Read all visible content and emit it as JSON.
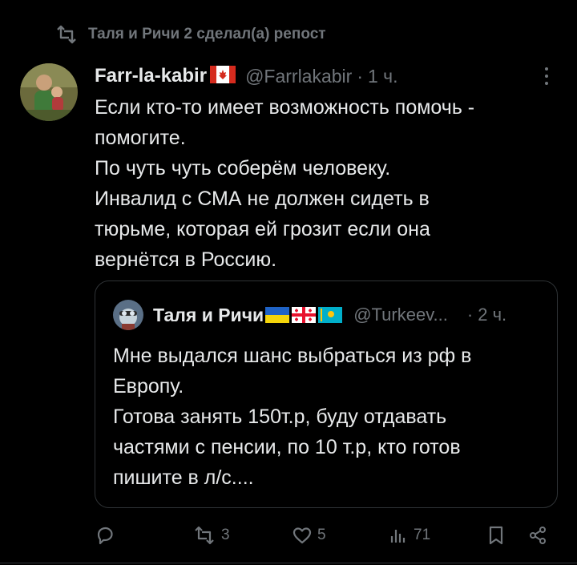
{
  "repost": {
    "label": "Таля и Ричи 2 сделал(а) репост",
    "icon": "repost-icon"
  },
  "tweet": {
    "author_name": "Farr-la-kabir",
    "author_flag": "canada-flag",
    "handle": "@Farrlakabir",
    "separator": "·",
    "time": "1 ч.",
    "text_lines": [
      "Если кто-то имеет возможность помочь -",
      "помогите.",
      "По чуть чуть соберём человеку.",
      "Инвалид с СМА не должен сидеть в",
      "тюрьме, которая ей грозит если она",
      "вернётся в Россию."
    ]
  },
  "quote": {
    "author_name": "Таля и Ричи",
    "flags": [
      "ukraine-flag",
      "georgia-flag",
      "kazakhstan-flag"
    ],
    "handle": "@Turkeev...",
    "separator": "·",
    "time": "2 ч.",
    "text_lines": [
      "Мне выдался шанс выбраться из рф в",
      "Европу.",
      "Готова занять 150т.р, буду отдавать",
      "частями с пенсии, по 10 т.р, кто готов",
      "пишите в л/с...."
    ]
  },
  "actions": {
    "reply_count": "",
    "repost_count": "3",
    "like_count": "5",
    "view_count": "71"
  },
  "colors": {
    "background": "#000000",
    "text": "#e7e9ea",
    "secondary": "#71767b",
    "border": "#2f3336"
  }
}
